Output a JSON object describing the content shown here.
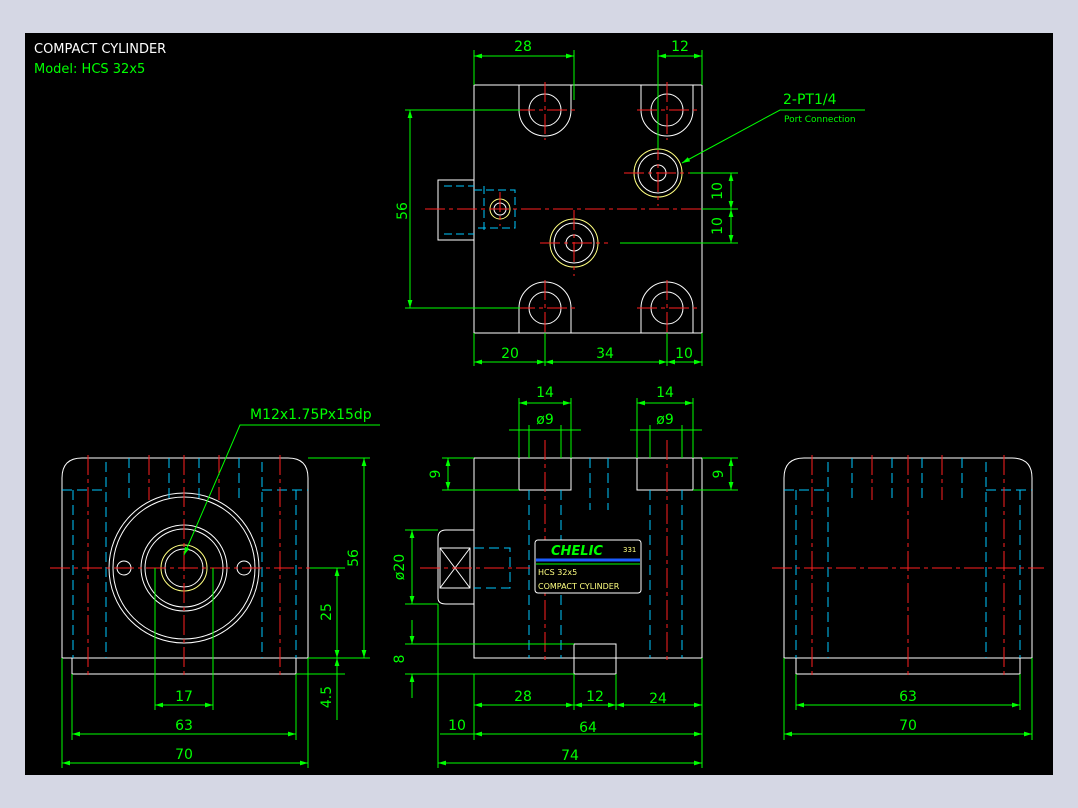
{
  "header": {
    "title": "COMPACT CYLINDER",
    "model": "Model: HCS 32x5"
  },
  "top_view": {
    "dim_top_left": "28",
    "dim_top_right": "12",
    "dim_height": "56",
    "dim_right_a": "10",
    "dim_right_b": "10",
    "dim_bottom_left": "20",
    "dim_bottom_mid": "34",
    "dim_bottom_right": "10",
    "port_label": "2-PT1/4",
    "port_sublabel": "Port Connection"
  },
  "left_view": {
    "thread_label": "M12x1.75Px15dp",
    "dim_height": "56",
    "dim_center": "25",
    "dim_base": "4.5",
    "dim_bore": "17",
    "dim_inner_width": "63",
    "dim_width": "70"
  },
  "front_view": {
    "dim_hole_left": "14",
    "dim_hole_right": "14",
    "dim_dia_left": "ø9",
    "dim_dia_right": "ø9",
    "dim_depth_left": "9",
    "dim_depth_right": "9",
    "dim_rod_dia": "ø20",
    "dim_foot": "8",
    "dim_b1": "28",
    "dim_b2": "12",
    "dim_b3": "24",
    "dim_rod": "10",
    "dim_body": "64",
    "dim_total": "74",
    "brand": "CHELIC",
    "brand_code": "331",
    "label_model": "HCS 32x5",
    "label_name": "COMPACT CYLINDER"
  },
  "right_view": {
    "dim_inner_width": "63",
    "dim_width": "70"
  },
  "colors": {
    "outline": "#ffffff",
    "hidden": "#00c8ff",
    "center": "#ff2020",
    "dimension": "#00ff00",
    "port": "#ffff80",
    "background": "#000000",
    "frame": "#d5d7e4"
  }
}
